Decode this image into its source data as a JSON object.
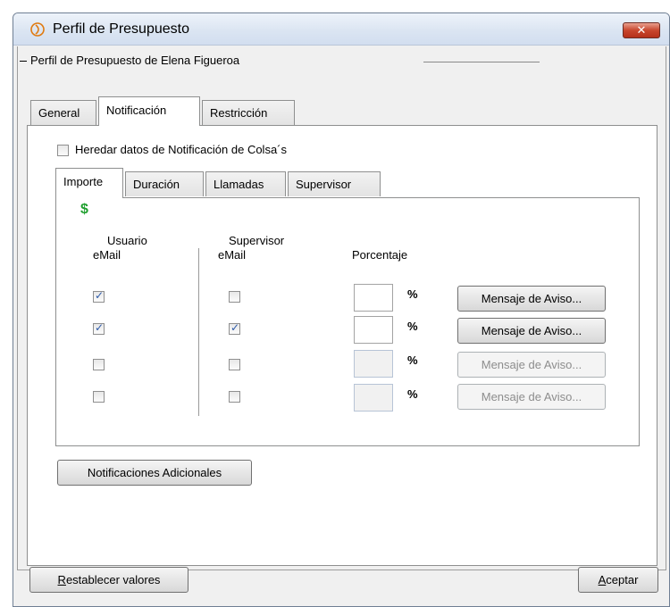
{
  "window": {
    "title": "Perfil de Presupuesto",
    "close_glyph": "✕"
  },
  "group": {
    "title": "Perfil de Presupuesto de Elena Figueroa"
  },
  "tabs": [
    {
      "label": "General"
    },
    {
      "label": "Notificación"
    },
    {
      "label": "Restricción"
    }
  ],
  "inherit": {
    "label": "Heredar datos de Notificación de Colsa´s",
    "checked": false
  },
  "subtabs": [
    {
      "label": "Importe"
    },
    {
      "label": "Duración"
    },
    {
      "label": "Llamadas"
    },
    {
      "label": "Supervisor"
    }
  ],
  "importe": {
    "currency_symbol": "$",
    "col_usuario": "Usuario",
    "col_usuario_sub": "eMail",
    "col_supervisor": "Supervisor",
    "col_supervisor_sub": "eMail",
    "col_porcentaje": "Porcentaje",
    "percent_sign": "%",
    "rows": [
      {
        "usuario_email": true,
        "supervisor_email": false,
        "porcentaje": "",
        "enabled": true,
        "button": "Mensaje de Aviso..."
      },
      {
        "usuario_email": true,
        "supervisor_email": true,
        "porcentaje": "",
        "enabled": true,
        "button": "Mensaje de Aviso..."
      },
      {
        "usuario_email": false,
        "supervisor_email": false,
        "porcentaje": "",
        "enabled": false,
        "button": "Mensaje de Aviso..."
      },
      {
        "usuario_email": false,
        "supervisor_email": false,
        "porcentaje": "",
        "enabled": false,
        "button": "Mensaje de Aviso..."
      }
    ]
  },
  "buttons": {
    "additional": "Notificaciones Adicionales",
    "reset_first": "R",
    "reset_rest": "establecer valores",
    "accept_first": "A",
    "accept_rest": "ceptar"
  }
}
